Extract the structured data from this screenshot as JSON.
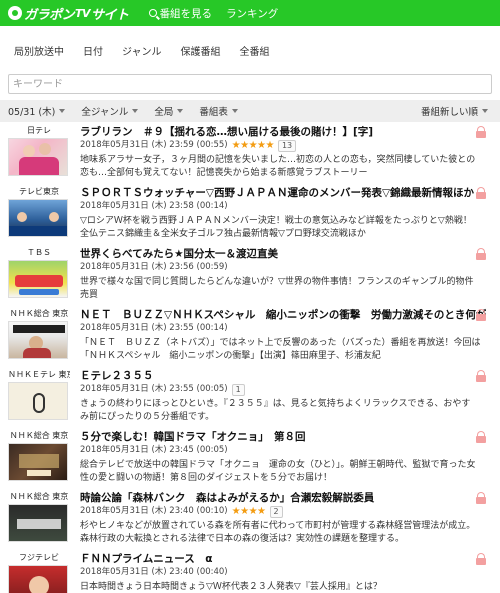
{
  "header": {
    "logo_main": "ガラポン",
    "logo_tv": "TV",
    "logo_tail": "サイト",
    "nav": [
      {
        "label": "番組を見る",
        "icon": "search-icon"
      },
      {
        "label": "ランキング"
      }
    ]
  },
  "subnav": [
    "局別放送中",
    "日付",
    "ジャンル",
    "保護番組",
    "全番組"
  ],
  "search": {
    "placeholder": "キーワード",
    "value": ""
  },
  "filters": {
    "date": "05/31 (木)",
    "genre": "全ジャンル",
    "station": "全局",
    "view": "番組表",
    "sort": "番組新しい順"
  },
  "colors": {
    "brand": "#27c827",
    "star": "#f39c12",
    "lock": "#f3a0a0"
  },
  "programs": [
    {
      "channel": "日テレ",
      "title": "ラブリラン　＃９【揺れる恋…想い届ける最後の賭け！】[字]",
      "datetime": "2018年05月31日 (木) 23:59 (00:55)",
      "stars": "★★★★★",
      "rating": 5,
      "count": "13",
      "desc": "地味系アラサー女子，３ヶ月間の記憶を失いました…初恋の人との恋も，突然同棲していた彼との恋も…全部何も覚えてない！記憶喪失から始まる新感覚ラブストーリー"
    },
    {
      "channel": "テレビ東京",
      "title": "ＳＰＯＲＴＳウォッチャー▽西野ＪＡＰＡＮ運命のメンバー発表▽錦織最新情報ほか",
      "datetime": "2018年05月31日 (木) 23:58 (00:14)",
      "desc": "▽ロシアＷ杯を戦う西野ＪＡＰＡＮメンバー決定！戦士の意気込みなど詳報をたっぷりと▽熱戦！全仏テニス錦織圭＆全米女子ゴルフ独占最新情報▽プロ野球交流戦ほか"
    },
    {
      "channel": "ＴＢＳ",
      "title": "世界くらべてみたら★国分太一＆渡辺直美",
      "datetime": "2018年05月31日 (木) 23:56 (00:59)",
      "desc": "世界で様々な国で同じ質問したらどんな違いが？▽世界の物件事情！フランスのギャンブル的物件売買"
    },
    {
      "channel": "ＮＨＫ総合 東京",
      "title": "ＮＥＴ　ＢＵＺＺ▽ＮＨＫスペシャル　縮小ニッポンの衝撃　労働力激減そのとき何が",
      "datetime": "2018年05月31日 (木) 23:55 (00:14)",
      "desc": "「ＮＥＴ　ＢＵＺＺ（ネトバズ）」ではネット上で反響のあった（バズった）番組を再放送！今回は「ＮＨＫスペシャル　縮小ニッポンの衝撃」【出演】篠田麻里子、杉浦友紀"
    },
    {
      "channel": "ＮＨＫＥテレ 東京",
      "title": "Ｅテレ２３５５",
      "datetime": "2018年05月31日 (木) 23:55 (00:05)",
      "count": "1",
      "desc": "きょうの終わりにほっとひといき。『２３５５』は、見ると気持ちよくリラックスできる、おやすみ前にぴったりの５分番組です。"
    },
    {
      "channel": "ＮＨＫ総合 東京",
      "title": "５分で楽しむ！韓国ドラマ「オクニョ」　第８回",
      "datetime": "2018年05月31日 (木) 23:45 (00:05)",
      "desc": "総合テレビで放送中の韓国ドラマ「オクニョ　運命の女（ひと）」。朝鮮王朝時代、監獄で育った女性の愛と闘いの物語！第８回のダイジェストを５分でお届け！"
    },
    {
      "channel": "ＮＨＫ総合 東京",
      "title": "時論公論「森林バンク　森はよみがえるか」合瀬宏毅解説委員",
      "datetime": "2018年05月31日 (木) 23:40 (00:10)",
      "stars": "★★★★",
      "rating": 4,
      "count": "2",
      "desc": "杉やヒノキなどが放置されている森を所有者に代わって市町村が管理する森林経営管理法が成立。森林行政の大転換とされる法律で日本の森の復活は？実効性の課題を整理する。"
    },
    {
      "channel": "フジテレビ",
      "title": "ＦＮＮプライムニュース　α",
      "datetime": "2018年05月31日 (木) 23:40 (00:40)",
      "desc": "日本時間きょう日本時間きょう▽Ｗ杯代表２３人発表▽『芸人採用』とは？"
    }
  ]
}
